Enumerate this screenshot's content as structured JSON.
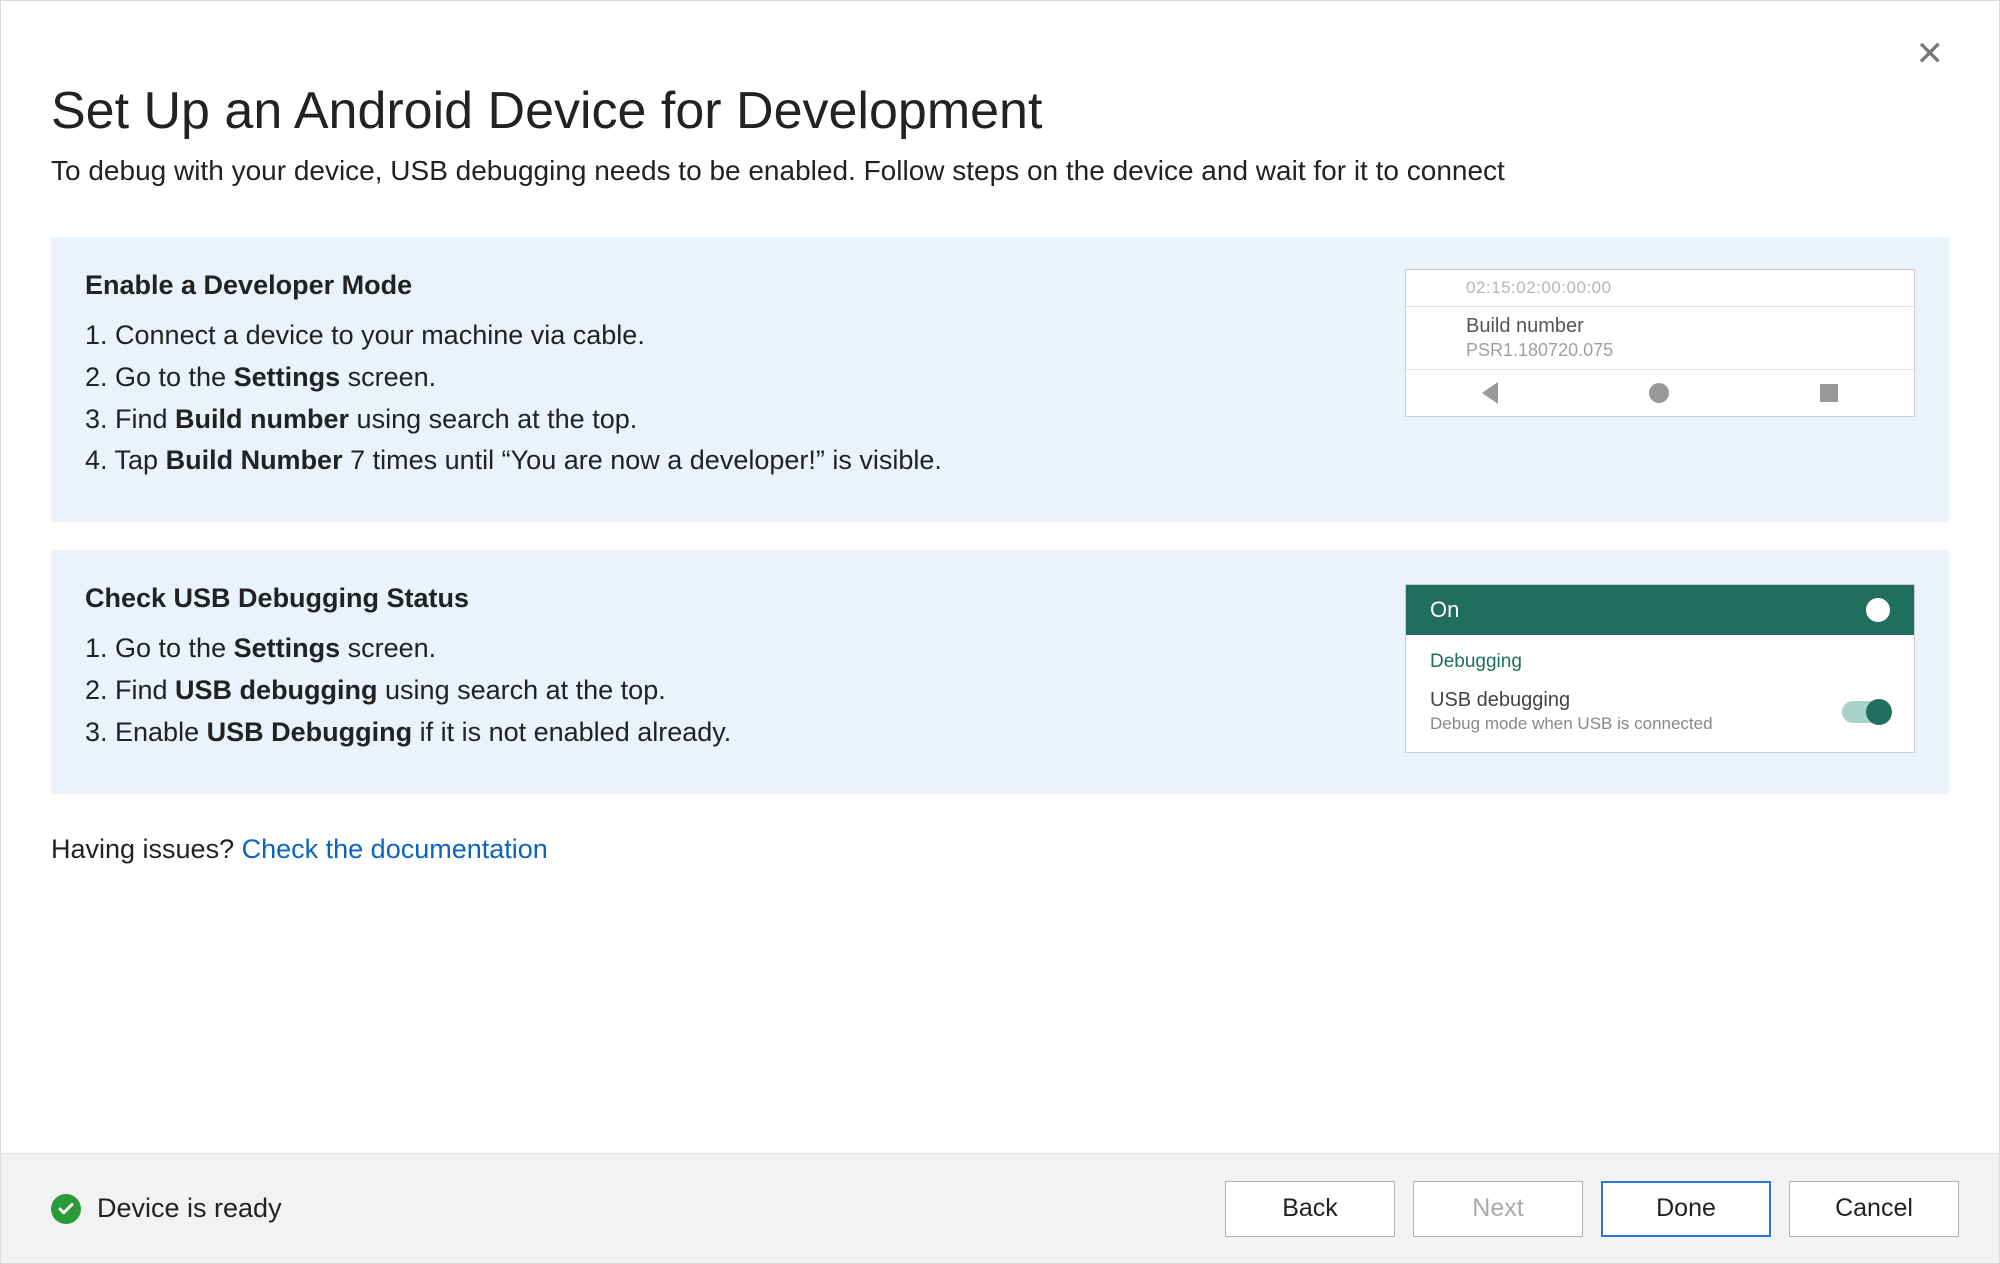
{
  "header": {
    "title": "Set Up an Android Device for Development",
    "subtitle": "To debug with your device, USB debugging needs to be enabled. Follow steps on the device and wait for it to connect"
  },
  "panel1": {
    "heading": "Enable a Developer Mode",
    "step1_pre": "1. Connect a device to your machine via cable.",
    "step2_pre": "2. Go to the ",
    "step2_b": "Settings",
    "step2_post": " screen.",
    "step3_pre": "3. Find ",
    "step3_b": "Build number",
    "step3_post": " using search at the top.",
    "step4_pre": "4. Tap ",
    "step4_b": "Build Number",
    "step4_post": " 7 times until “You are now a developer!” is visible."
  },
  "mock1": {
    "truncated_top": "02:15:02:00:00:00",
    "build_label": "Build number",
    "build_value": "PSR1.180720.075"
  },
  "panel2": {
    "heading": "Check USB Debugging Status",
    "step1_pre": "1. Go to the ",
    "step1_b": "Settings",
    "step1_post": " screen.",
    "step2_pre": "2. Find ",
    "step2_b": "USB debugging",
    "step2_post": " using search at the top.",
    "step3_pre": "3. Enable ",
    "step3_b": "USB Debugging",
    "step3_post": " if it is not enabled already."
  },
  "mock2": {
    "top_label": "On",
    "section": "Debugging",
    "item_title": "USB debugging",
    "item_sub": "Debug mode when USB is connected"
  },
  "issues": {
    "prefix": "Having issues? ",
    "link": "Check the documentation"
  },
  "footer": {
    "status": "Device is ready",
    "back": "Back",
    "next": "Next",
    "done": "Done",
    "cancel": "Cancel"
  }
}
